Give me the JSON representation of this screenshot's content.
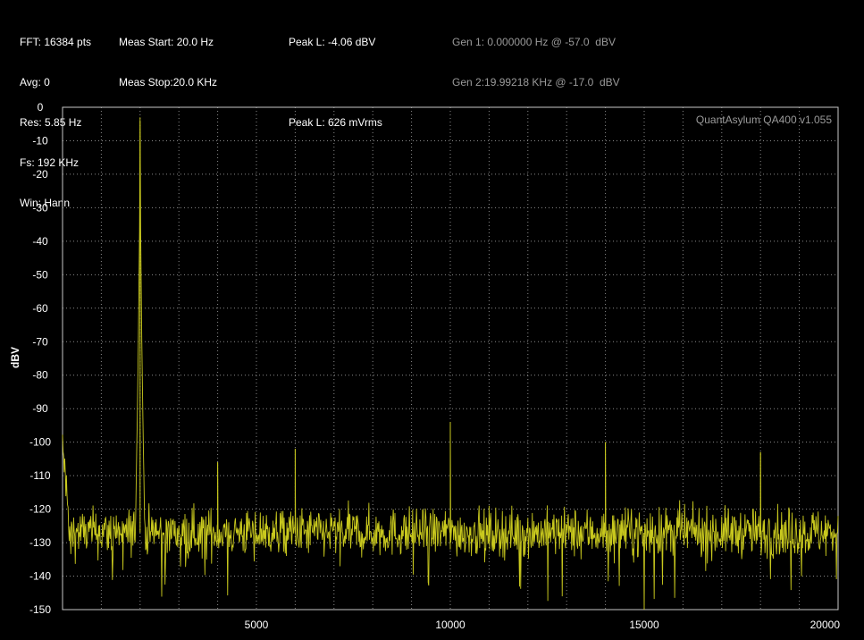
{
  "info": {
    "fft": "FFT: 16384 pts",
    "avg": "Avg: 0",
    "res": "Res: 5.85 Hz",
    "fs": "Fs: 192 KHz",
    "win": "Win: Hann",
    "meas_start": "Meas Start: 20.0 Hz",
    "meas_stop": "Meas Stop:20.0 KHz",
    "peak_dbv": "Peak L: -4.06 dBV",
    "peak_mvrms": "Peak L: 626 mVrms",
    "gen1": "Gen 1: 0.000000 Hz @ -57.0  dBV",
    "gen2": "Gen 2:19.99218 KHz @ -17.0  dBV"
  },
  "colors": {
    "background": "#000000",
    "trace": "#c8c81e",
    "grid": "#8a8a8a",
    "frame": "#c8c8c8",
    "text": "#ffffff",
    "dim_text": "#9a9a9a"
  },
  "chart_data": {
    "type": "line",
    "title": "",
    "watermark": "QuantAsylum QA400 v1.055",
    "xlabel": "",
    "ylabel": "dBV",
    "xlim": [
      0,
      20000
    ],
    "ylim": [
      -150,
      0
    ],
    "x_ticks": [
      5000,
      10000,
      15000,
      20000
    ],
    "y_ticks": [
      0,
      -10,
      -20,
      -30,
      -40,
      -50,
      -60,
      -70,
      -80,
      -90,
      -100,
      -110,
      -120,
      -130,
      -140,
      -150
    ],
    "grid": true,
    "noise_floor_dbv": -127,
    "noise_spread_dbv": [
      -145,
      -115
    ],
    "peaks": [
      {
        "freq_hz": 2000,
        "level_dbv": -4.06
      },
      {
        "freq_hz": 4000,
        "level_dbv": -106
      },
      {
        "freq_hz": 6000,
        "level_dbv": -102
      },
      {
        "freq_hz": 10000,
        "level_dbv": -94
      },
      {
        "freq_hz": 14000,
        "level_dbv": -100
      },
      {
        "freq_hz": 18000,
        "level_dbv": -103
      }
    ],
    "series": [
      {
        "values_description_points": [
          [
            0,
            -100
          ],
          [
            1000,
            -125
          ],
          [
            1500,
            -122
          ],
          [
            1700,
            -112
          ],
          [
            1900,
            -70
          ],
          [
            2000,
            -4.06
          ],
          [
            2100,
            -70
          ],
          [
            2300,
            -112
          ],
          [
            2500,
            -124
          ],
          [
            4000,
            -106
          ],
          [
            6000,
            -102
          ],
          [
            10000,
            -94
          ],
          [
            14000,
            -100
          ],
          [
            18000,
            -103
          ],
          [
            20000,
            -128
          ]
        ]
      }
    ]
  }
}
